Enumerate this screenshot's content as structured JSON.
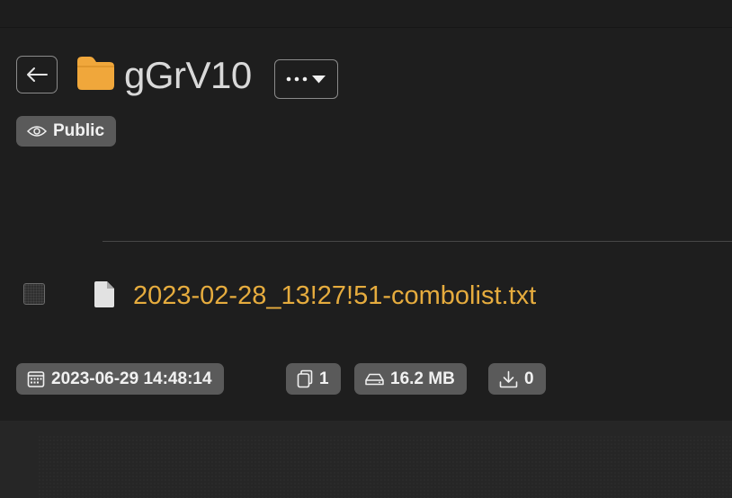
{
  "header": {
    "back_icon": "arrow-left-icon",
    "folder_icon": "folder-icon",
    "folder_name": "gGrV10",
    "more_icon": "ellipsis-icon",
    "dropdown_icon": "caret-down-icon"
  },
  "visibility": {
    "icon": "eye-icon",
    "label": "Public"
  },
  "files": [
    {
      "icon": "file-icon",
      "name": "2023-02-28_13!27!51-combolist.txt",
      "checked": false
    }
  ],
  "meta": {
    "date": {
      "icon": "calendar-icon",
      "value": "2023-06-29 14:48:14"
    },
    "file_count": {
      "icon": "copy-icon",
      "value": "1"
    },
    "size": {
      "icon": "hard-drive-icon",
      "value": "16.2 MB"
    },
    "downloads": {
      "icon": "download-icon",
      "value": "0"
    }
  },
  "colors": {
    "accent": "#e6ac3e",
    "folder": "#f0a73b",
    "badge_bg": "#5a5a5a",
    "background": "#1e1e1e",
    "text": "#d9d9d9"
  }
}
